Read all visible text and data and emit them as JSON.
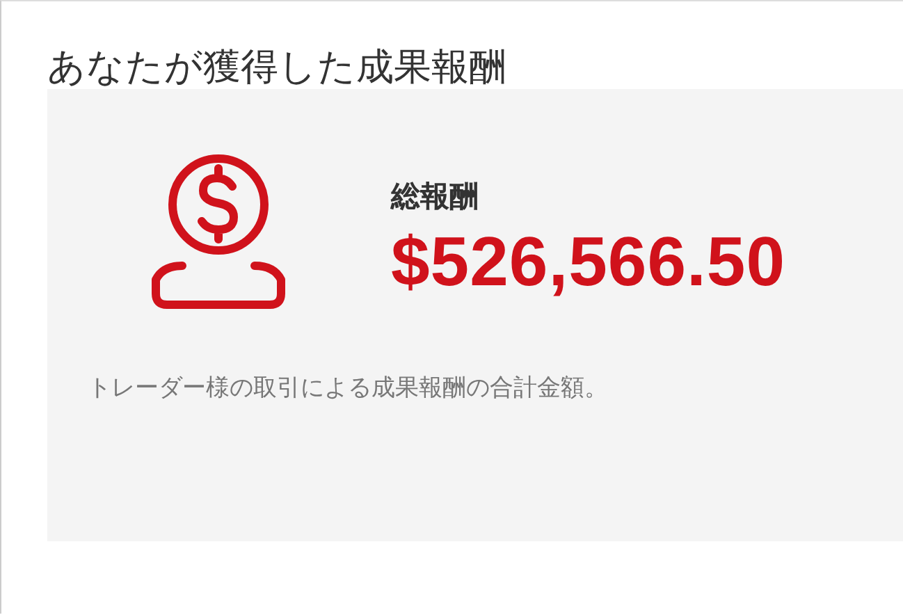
{
  "title": "あなたが獲得した成果報酬",
  "summary": {
    "label": "総報酬",
    "amount": "$526,566.50",
    "description": "トレーダー様の取引による成果報酬の合計金額。"
  }
}
